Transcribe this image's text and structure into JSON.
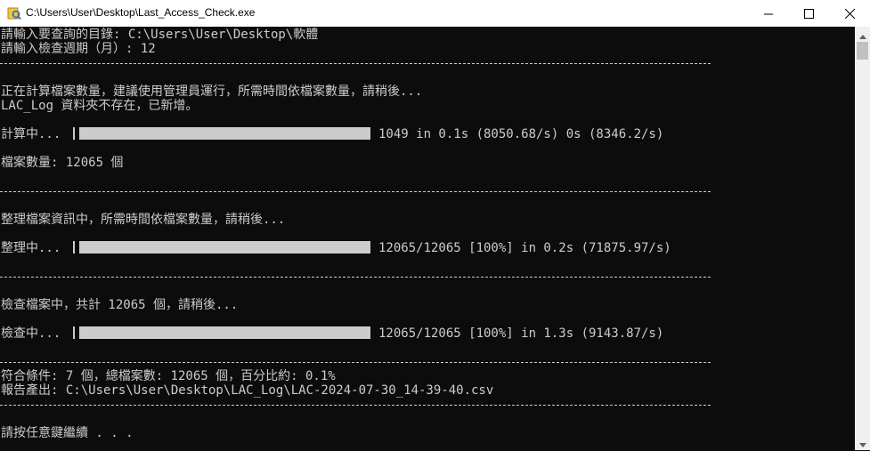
{
  "window": {
    "title": "C:\\Users\\User\\Desktop\\Last_Access_Check.exe",
    "icons": [
      "app-icon",
      "minimize-icon",
      "maximize-icon",
      "close-icon"
    ]
  },
  "console": {
    "prompt_dir": "請輸入要查詢的目錄: C:\\Users\\User\\Desktop\\軟體",
    "prompt_period": "請輸入檢查週期（月）: 12",
    "counting_notice": "正在計算檔案數量，建議使用管理員運行，所需時間依檔案數量，請稍後...",
    "folder_notice": "LAC_Log 資料夾不存在，已新增。",
    "calc_label": "計算中...",
    "calc_stats": "1049 in 0.1s (8050.68/s) 0s (8346.2/s)",
    "file_count": "檔案數量: 12065 個",
    "organizing_notice": "整理檔案資訊中，所需時間依檔案數量，請稍後...",
    "organize_label": "整理中...",
    "organize_stats": "12065/12065 [100%] in 0.2s (71875.97/s)",
    "checking_notice": "檢查檔案中，共計 12065 個，請稍後...",
    "check_label": "檢查中...",
    "check_stats": "12065/12065 [100%] in 1.3s (9143.87/s)",
    "result_summary": "符合條件: 7 個，總檔案數: 12065 個，百分比約: 0.1%",
    "report_output": "報告產出: C:\\Users\\User\\Desktop\\LAC_Log\\LAC-2024-07-30_14-39-40.csv",
    "press_any_key": "請按任意鍵繼續 . . .",
    "progress": {
      "calc": 1.0,
      "organize": 1.0,
      "check": 1.0
    }
  },
  "colors": {
    "console_bg": "#0c0c0c",
    "console_fg": "#cccccc",
    "titlebar_bg": "#ffffff"
  }
}
